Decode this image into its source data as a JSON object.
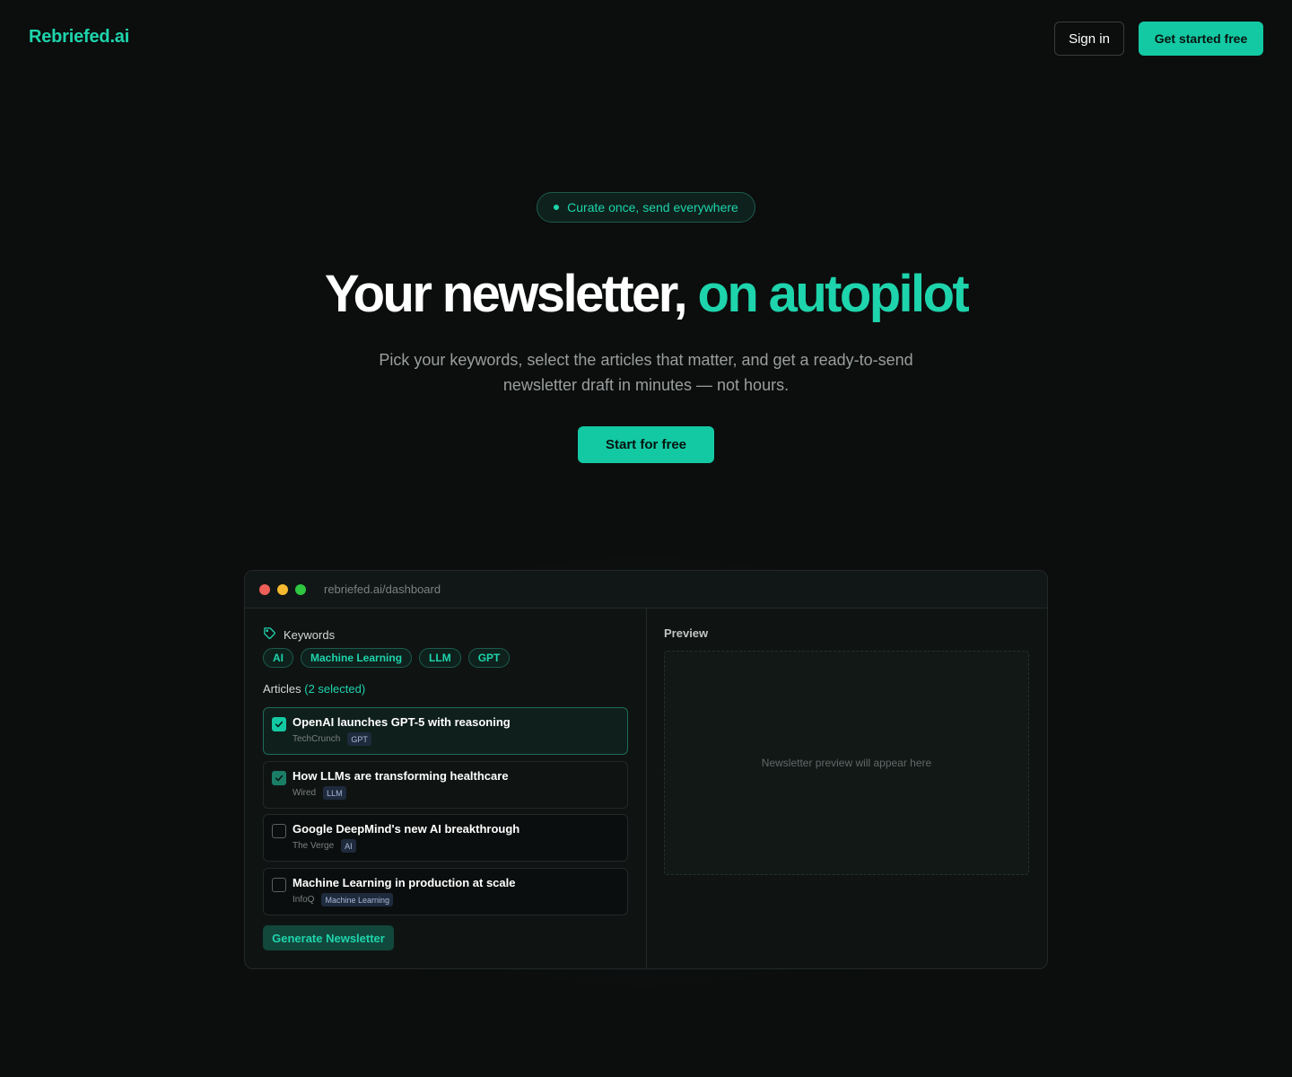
{
  "brand": {
    "logo": "Rebriefed.ai",
    "accent_color": "#13c9a4"
  },
  "nav": {
    "signin_label": "Sign in",
    "get_started_label": "Get started free"
  },
  "hero": {
    "pill_text": "Curate once, send everywhere",
    "headline_main": "Your newsletter,",
    "headline_accent": "on autopilot",
    "subtitle": "Pick your keywords, select the articles that matter, and get a ready-to-send newsletter draft in minutes — not hours.",
    "cta_label": "Start for free"
  },
  "window": {
    "url": "rebriefed.ai/dashboard",
    "keywords_label": "Keywords",
    "keywords": [
      "AI",
      "Machine Learning",
      "LLM",
      "GPT"
    ],
    "articles_label": "Articles",
    "articles_selected": "(2 selected)",
    "articles": [
      {
        "title": "OpenAI launches GPT-5 with reasoning",
        "source": "TechCrunch",
        "tag": "GPT",
        "checked": true
      },
      {
        "title": "How LLMs are transforming healthcare",
        "source": "Wired",
        "tag": "LLM",
        "checked": true
      },
      {
        "title": "Google DeepMind's new AI breakthrough",
        "source": "The Verge",
        "tag": "AI",
        "checked": false
      },
      {
        "title": "Machine Learning in production at scale",
        "source": "InfoQ",
        "tag": "Machine Learning",
        "checked": false
      }
    ],
    "generate_label": "Generate Newsletter",
    "preview_label": "Preview",
    "preview_placeholder": "Newsletter preview will appear here"
  }
}
